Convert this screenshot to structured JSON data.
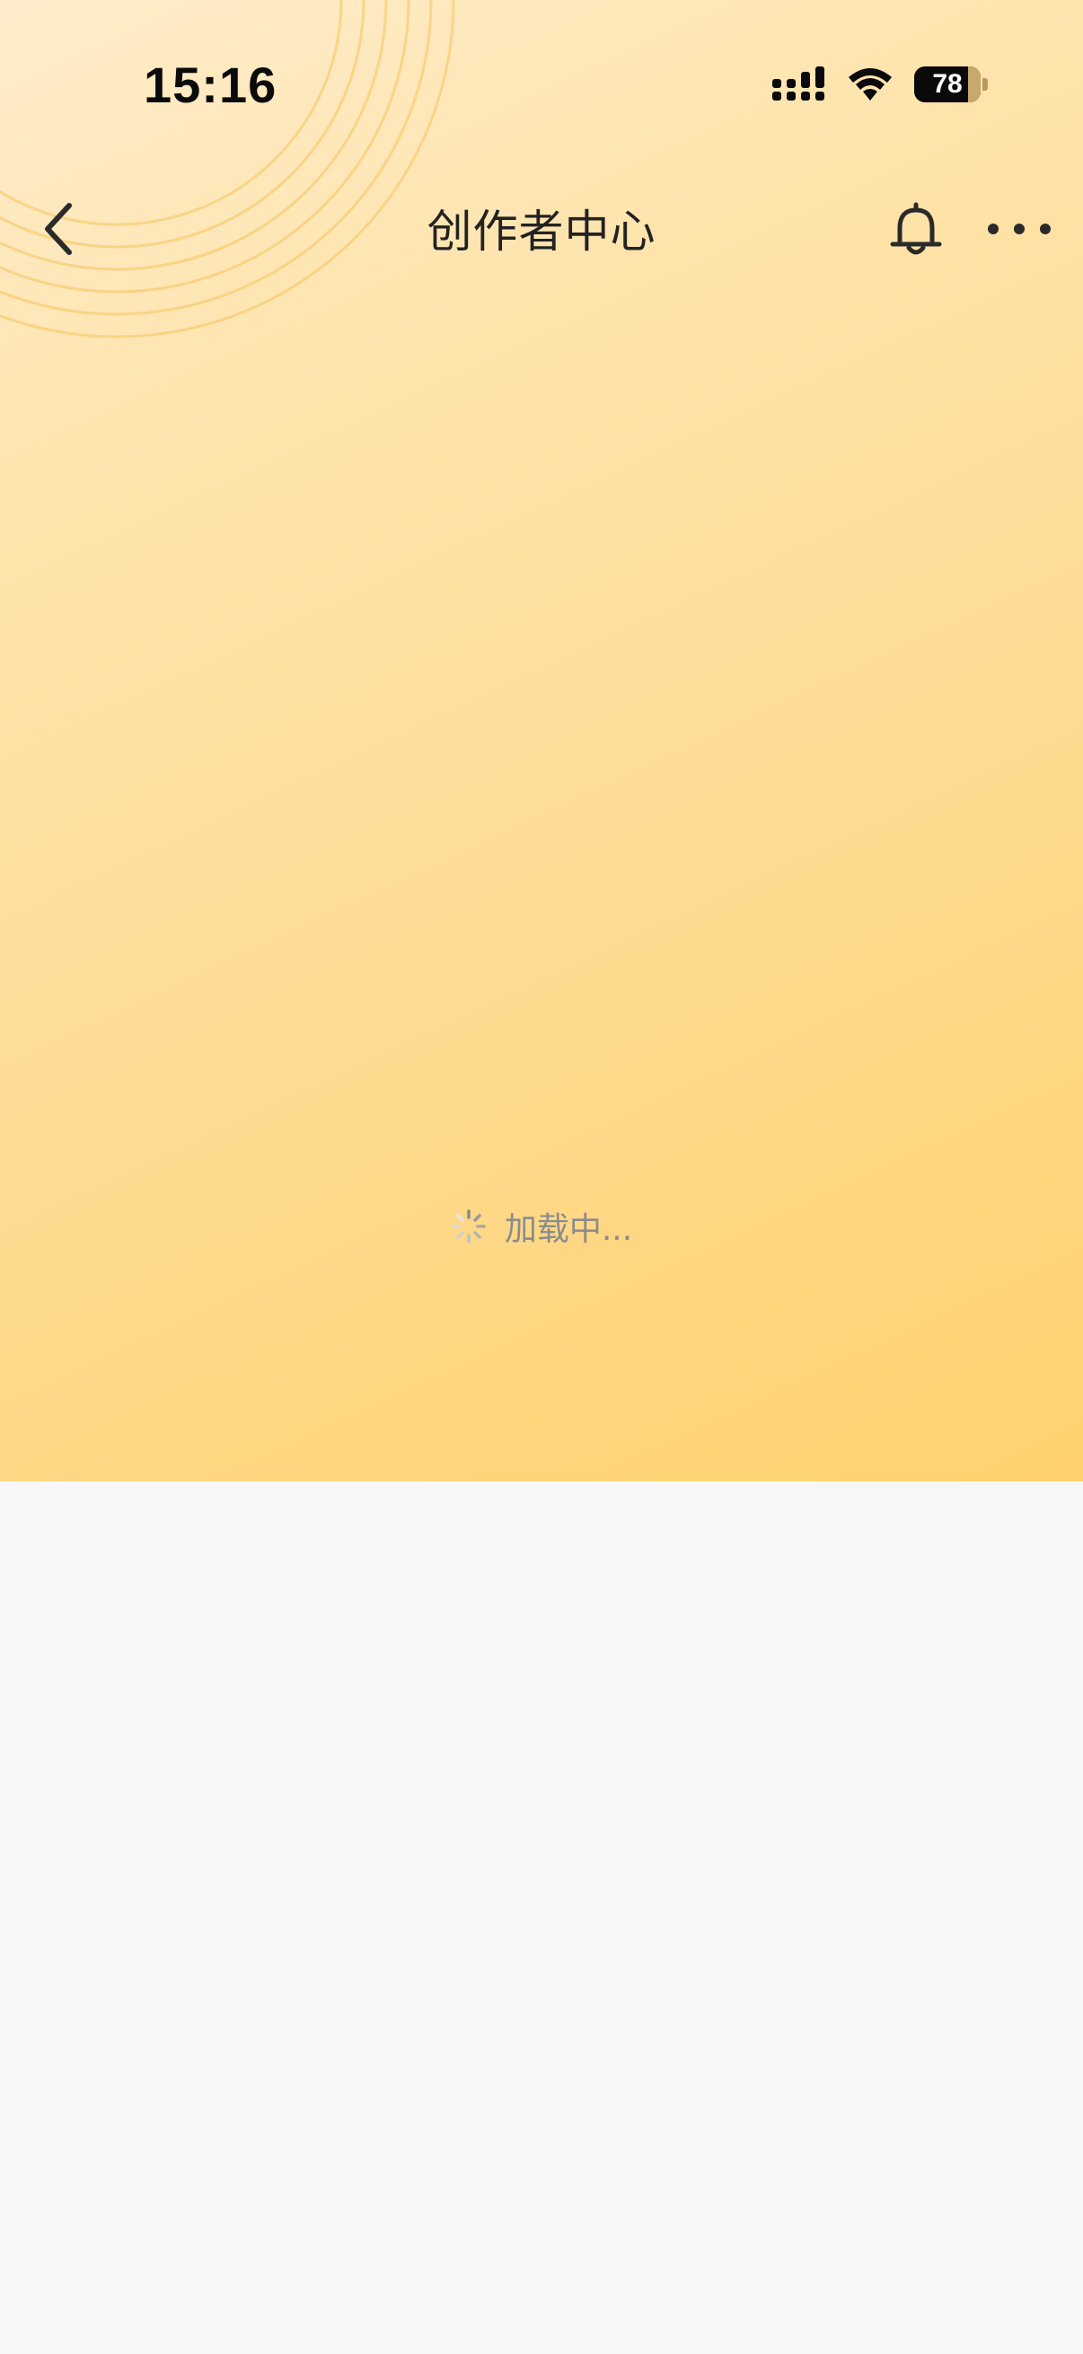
{
  "status_bar": {
    "time": "15:16",
    "battery_level": "78",
    "icons": [
      "signal-icon",
      "wifi-icon",
      "battery-icon"
    ]
  },
  "nav": {
    "title": "创作者中心",
    "icons": [
      "back-arrow-icon",
      "bell-icon",
      "more-dots-icon"
    ]
  },
  "loading": {
    "text": "加载中...",
    "icon": "spinner-icon"
  },
  "colors": {
    "hero_gradient_start": "#ffeccb",
    "hero_gradient_end": "#ffd26e",
    "page_background": "#f7f7f7",
    "title_text": "#222222",
    "loading_text": "#8c8c8c"
  }
}
